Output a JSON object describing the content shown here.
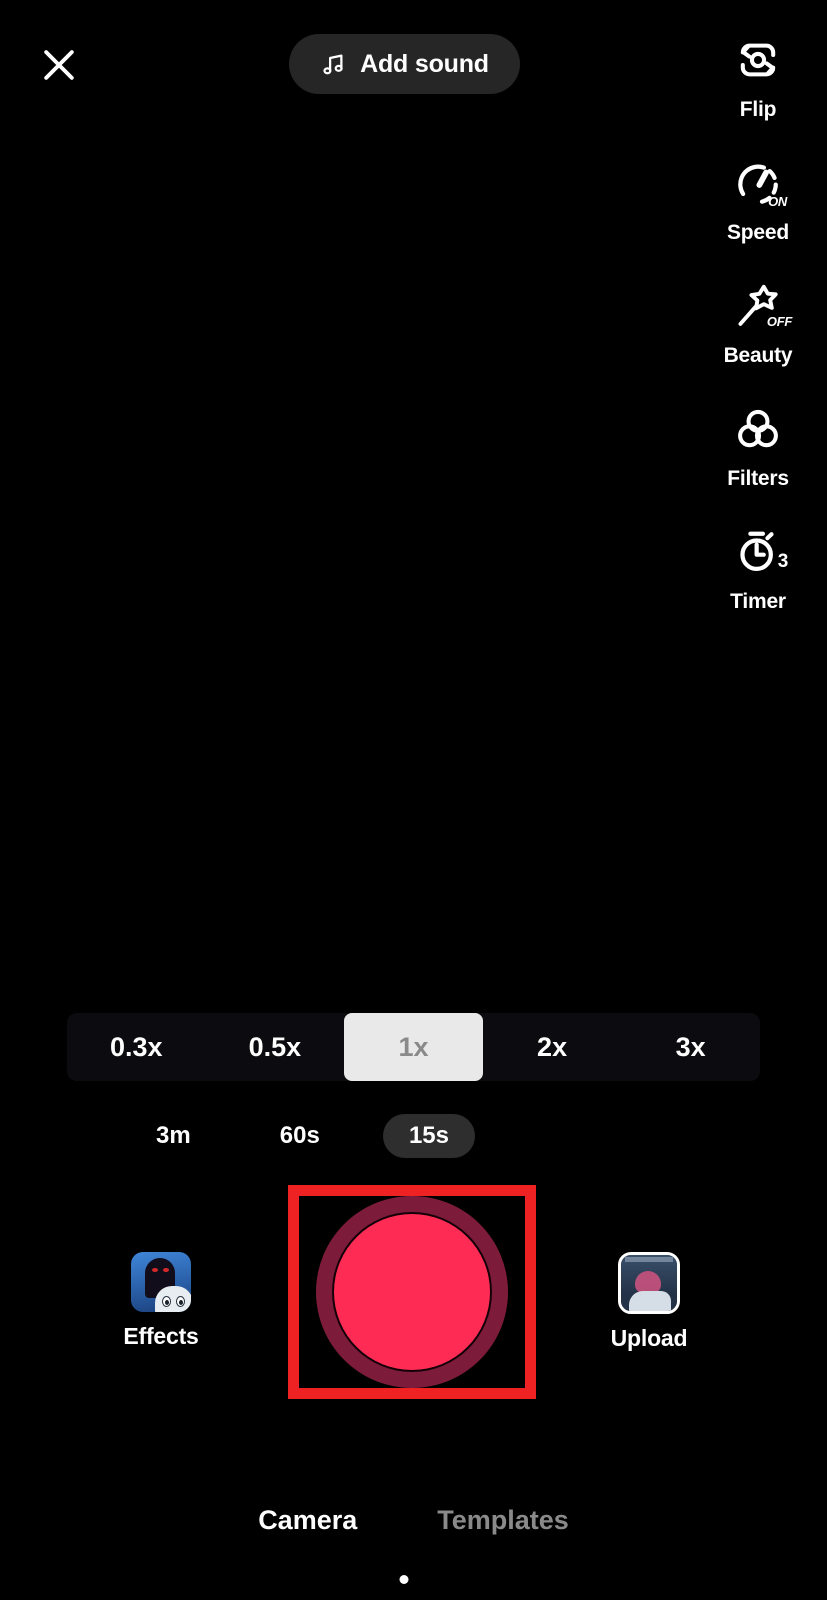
{
  "app": {
    "name": "TikTok Camera",
    "screen": "record"
  },
  "topbar": {
    "close_icon": "close-icon",
    "add_sound": {
      "label": "Add sound",
      "icon": "music-note-icon"
    }
  },
  "right_rail": {
    "items": [
      {
        "id": "flip",
        "label": "Flip",
        "icon": "camera-flip-icon",
        "badge": ""
      },
      {
        "id": "speed",
        "label": "Speed",
        "icon": "speedometer-icon",
        "badge": "ON"
      },
      {
        "id": "beauty",
        "label": "Beauty",
        "icon": "magic-wand-icon",
        "badge": "OFF"
      },
      {
        "id": "filters",
        "label": "Filters",
        "icon": "three-circles-icon",
        "badge": ""
      },
      {
        "id": "timer",
        "label": "Timer",
        "icon": "stopwatch-icon",
        "badge": "3"
      }
    ]
  },
  "zoom_bar": {
    "options": [
      {
        "label": "0.3x",
        "active": false
      },
      {
        "label": "0.5x",
        "active": false
      },
      {
        "label": "1x",
        "active": true
      },
      {
        "label": "2x",
        "active": false
      },
      {
        "label": "3x",
        "active": false
      }
    ],
    "selected": "1x"
  },
  "duration_bar": {
    "options": [
      {
        "label": "3m",
        "active": false
      },
      {
        "label": "60s",
        "active": false
      },
      {
        "label": "15s",
        "active": true
      }
    ],
    "selected": "15s"
  },
  "record": {
    "button_name": "record-button",
    "highlighted": true,
    "highlight_color": "#ee2222",
    "core_color": "#fe2c55",
    "ring_color": "#8e2042"
  },
  "effects": {
    "label": "Effects",
    "thumb_icon": "effects-thumbnail"
  },
  "upload": {
    "label": "Upload",
    "thumb_icon": "upload-thumbnail"
  },
  "bottom_tabs": {
    "items": [
      {
        "label": "Camera",
        "active": true
      },
      {
        "label": "Templates",
        "active": false
      }
    ],
    "selected": "Camera"
  }
}
